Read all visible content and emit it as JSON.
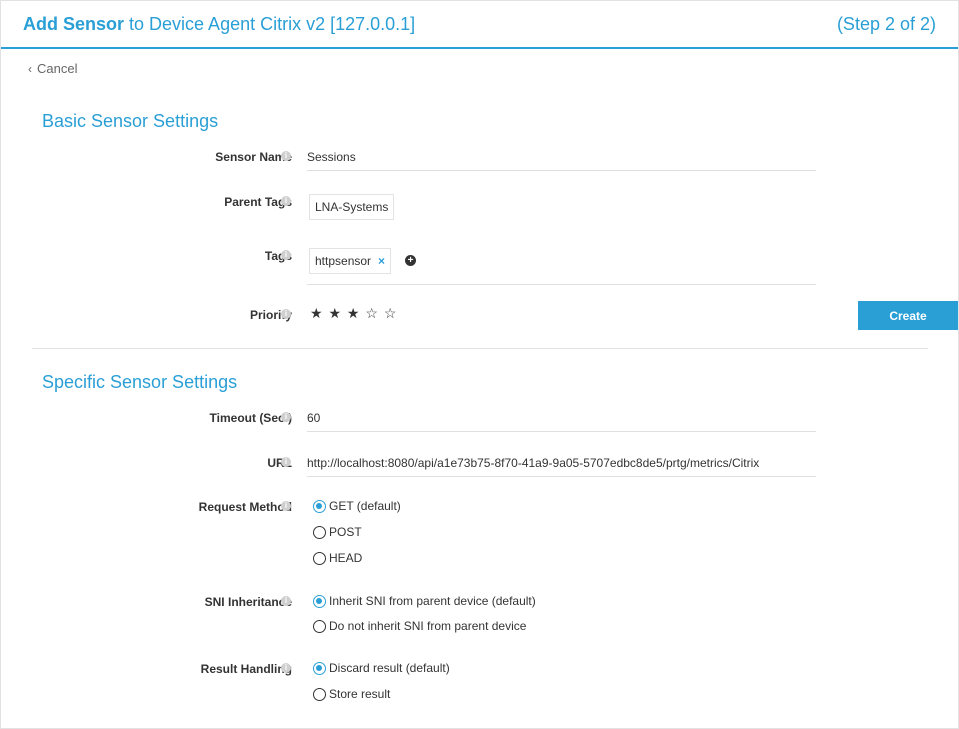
{
  "header": {
    "title_bold": "Add Sensor",
    "title_rest": " to Device Agent Citrix v2 [127.0.0.1]",
    "step": "(Step 2 of 2)"
  },
  "nav": {
    "cancel_label": "Cancel"
  },
  "basic": {
    "section_title": "Basic Sensor Settings",
    "sensor_name": {
      "label": "Sensor Name",
      "value": "Sessions"
    },
    "parent_tags": {
      "label": "Parent Tags",
      "value": "LNA-Systems"
    },
    "tags": {
      "label": "Tags",
      "value": "httpsensor",
      "remove": "×",
      "add": "+"
    },
    "priority": {
      "label": "Priority",
      "stars": [
        "★",
        "★",
        "★",
        "☆",
        "☆"
      ],
      "rating": 3,
      "max": 5
    }
  },
  "actions": {
    "create_label": "Create"
  },
  "specific": {
    "section_title": "Specific Sensor Settings",
    "timeout": {
      "label": "Timeout (Sec.)",
      "value": "60"
    },
    "url": {
      "label": "URL",
      "value": "http://localhost:8080/api/a1e73b75-8f70-41a9-9a05-5707edbc8de5/prtg/metrics/Citrix"
    },
    "request_method": {
      "label": "Request Method",
      "options": [
        "GET (default)",
        "POST",
        "HEAD"
      ],
      "selected": "GET (default)"
    },
    "sni": {
      "label": "SNI Inheritance",
      "options": [
        "Inherit SNI from parent device (default)",
        "Do not inherit SNI from parent device"
      ],
      "selected": "Inherit SNI from parent device (default)"
    },
    "result_handling": {
      "label": "Result Handling",
      "options": [
        "Discard result (default)",
        "Store result"
      ],
      "selected": "Discard result (default)"
    }
  },
  "info_glyph": "i",
  "colors": {
    "accent": "#2a9fd6",
    "text": "#333333",
    "border": "#e2e2e2"
  }
}
